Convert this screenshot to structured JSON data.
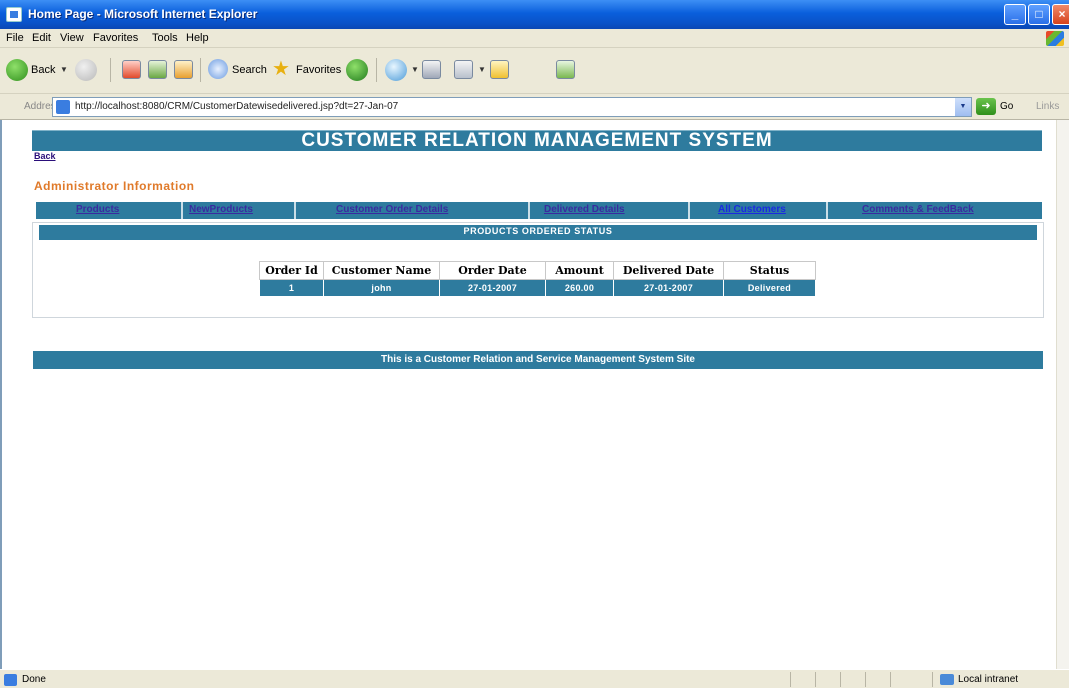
{
  "window": {
    "title": "Home Page - Microsoft Internet Explorer",
    "min_glyph": "_",
    "max_glyph": "□",
    "close_glyph": "×"
  },
  "menu": [
    "File",
    "Edit",
    "View",
    "Favorites",
    "Tools",
    "Help"
  ],
  "toolbar": {
    "back_label": "Back",
    "search_label": "Search",
    "favorites_label": "Favorites"
  },
  "address": {
    "label": "Address",
    "url": "http://localhost:8080/CRM/CustomerDatewisedelivered.jsp?dt=27-Jan-07",
    "go_label": "Go",
    "links_label": "Links"
  },
  "page": {
    "header_title": "CUSTOMER RELATION MANAGEMENT SYSTEM",
    "back_link": "Back",
    "admin_heading": "Administrator Information",
    "nav": [
      "Products",
      "NewProducts",
      "Customer Order Details",
      "Delivered Details",
      "All Customers",
      "Comments & FeedBack"
    ],
    "status_title": "PRODUCTS ORDERED STATUS",
    "table": {
      "headers": [
        "Order Id",
        "Customer Name",
        "Order Date",
        "Amount",
        "Delivered Date",
        "Status"
      ],
      "rows": [
        [
          "1",
          "john",
          "27-01-2007",
          "260.00",
          "27-01-2007",
          "Delivered"
        ]
      ]
    },
    "footer_text": "This is a Customer Relation and Service Management System Site"
  },
  "statusbar": {
    "status": "Done",
    "zone": "Local intranet"
  },
  "colors": {
    "bar": "#2e7b9e",
    "heading": "#e07a2a",
    "link": "#3a2aa0"
  }
}
